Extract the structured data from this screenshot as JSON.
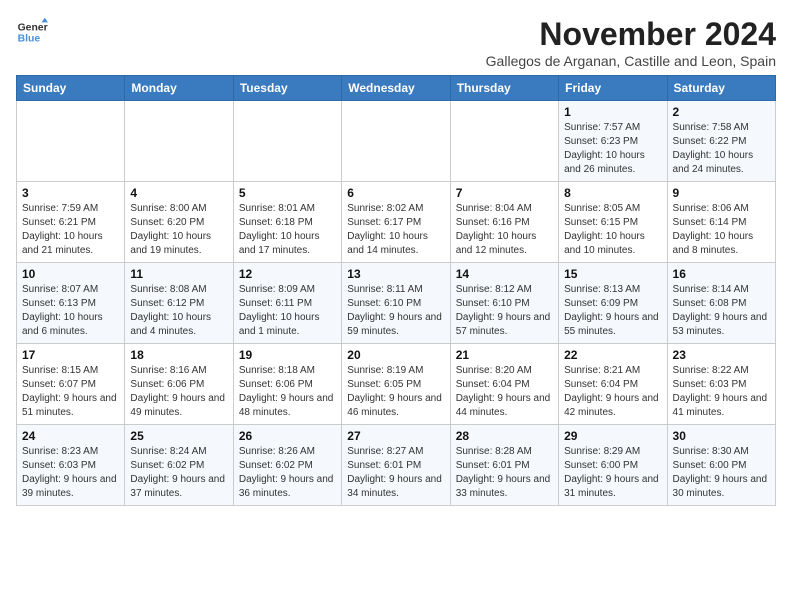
{
  "logo": {
    "line1": "General",
    "line2": "Blue"
  },
  "title": "November 2024",
  "location": "Gallegos de Arganan, Castille and Leon, Spain",
  "weekdays": [
    "Sunday",
    "Monday",
    "Tuesday",
    "Wednesday",
    "Thursday",
    "Friday",
    "Saturday"
  ],
  "weeks": [
    [
      {
        "day": "",
        "info": ""
      },
      {
        "day": "",
        "info": ""
      },
      {
        "day": "",
        "info": ""
      },
      {
        "day": "",
        "info": ""
      },
      {
        "day": "",
        "info": ""
      },
      {
        "day": "1",
        "info": "Sunrise: 7:57 AM\nSunset: 6:23 PM\nDaylight: 10 hours and 26 minutes."
      },
      {
        "day": "2",
        "info": "Sunrise: 7:58 AM\nSunset: 6:22 PM\nDaylight: 10 hours and 24 minutes."
      }
    ],
    [
      {
        "day": "3",
        "info": "Sunrise: 7:59 AM\nSunset: 6:21 PM\nDaylight: 10 hours and 21 minutes."
      },
      {
        "day": "4",
        "info": "Sunrise: 8:00 AM\nSunset: 6:20 PM\nDaylight: 10 hours and 19 minutes."
      },
      {
        "day": "5",
        "info": "Sunrise: 8:01 AM\nSunset: 6:18 PM\nDaylight: 10 hours and 17 minutes."
      },
      {
        "day": "6",
        "info": "Sunrise: 8:02 AM\nSunset: 6:17 PM\nDaylight: 10 hours and 14 minutes."
      },
      {
        "day": "7",
        "info": "Sunrise: 8:04 AM\nSunset: 6:16 PM\nDaylight: 10 hours and 12 minutes."
      },
      {
        "day": "8",
        "info": "Sunrise: 8:05 AM\nSunset: 6:15 PM\nDaylight: 10 hours and 10 minutes."
      },
      {
        "day": "9",
        "info": "Sunrise: 8:06 AM\nSunset: 6:14 PM\nDaylight: 10 hours and 8 minutes."
      }
    ],
    [
      {
        "day": "10",
        "info": "Sunrise: 8:07 AM\nSunset: 6:13 PM\nDaylight: 10 hours and 6 minutes."
      },
      {
        "day": "11",
        "info": "Sunrise: 8:08 AM\nSunset: 6:12 PM\nDaylight: 10 hours and 4 minutes."
      },
      {
        "day": "12",
        "info": "Sunrise: 8:09 AM\nSunset: 6:11 PM\nDaylight: 10 hours and 1 minute."
      },
      {
        "day": "13",
        "info": "Sunrise: 8:11 AM\nSunset: 6:10 PM\nDaylight: 9 hours and 59 minutes."
      },
      {
        "day": "14",
        "info": "Sunrise: 8:12 AM\nSunset: 6:10 PM\nDaylight: 9 hours and 57 minutes."
      },
      {
        "day": "15",
        "info": "Sunrise: 8:13 AM\nSunset: 6:09 PM\nDaylight: 9 hours and 55 minutes."
      },
      {
        "day": "16",
        "info": "Sunrise: 8:14 AM\nSunset: 6:08 PM\nDaylight: 9 hours and 53 minutes."
      }
    ],
    [
      {
        "day": "17",
        "info": "Sunrise: 8:15 AM\nSunset: 6:07 PM\nDaylight: 9 hours and 51 minutes."
      },
      {
        "day": "18",
        "info": "Sunrise: 8:16 AM\nSunset: 6:06 PM\nDaylight: 9 hours and 49 minutes."
      },
      {
        "day": "19",
        "info": "Sunrise: 8:18 AM\nSunset: 6:06 PM\nDaylight: 9 hours and 48 minutes."
      },
      {
        "day": "20",
        "info": "Sunrise: 8:19 AM\nSunset: 6:05 PM\nDaylight: 9 hours and 46 minutes."
      },
      {
        "day": "21",
        "info": "Sunrise: 8:20 AM\nSunset: 6:04 PM\nDaylight: 9 hours and 44 minutes."
      },
      {
        "day": "22",
        "info": "Sunrise: 8:21 AM\nSunset: 6:04 PM\nDaylight: 9 hours and 42 minutes."
      },
      {
        "day": "23",
        "info": "Sunrise: 8:22 AM\nSunset: 6:03 PM\nDaylight: 9 hours and 41 minutes."
      }
    ],
    [
      {
        "day": "24",
        "info": "Sunrise: 8:23 AM\nSunset: 6:03 PM\nDaylight: 9 hours and 39 minutes."
      },
      {
        "day": "25",
        "info": "Sunrise: 8:24 AM\nSunset: 6:02 PM\nDaylight: 9 hours and 37 minutes."
      },
      {
        "day": "26",
        "info": "Sunrise: 8:26 AM\nSunset: 6:02 PM\nDaylight: 9 hours and 36 minutes."
      },
      {
        "day": "27",
        "info": "Sunrise: 8:27 AM\nSunset: 6:01 PM\nDaylight: 9 hours and 34 minutes."
      },
      {
        "day": "28",
        "info": "Sunrise: 8:28 AM\nSunset: 6:01 PM\nDaylight: 9 hours and 33 minutes."
      },
      {
        "day": "29",
        "info": "Sunrise: 8:29 AM\nSunset: 6:00 PM\nDaylight: 9 hours and 31 minutes."
      },
      {
        "day": "30",
        "info": "Sunrise: 8:30 AM\nSunset: 6:00 PM\nDaylight: 9 hours and 30 minutes."
      }
    ]
  ]
}
